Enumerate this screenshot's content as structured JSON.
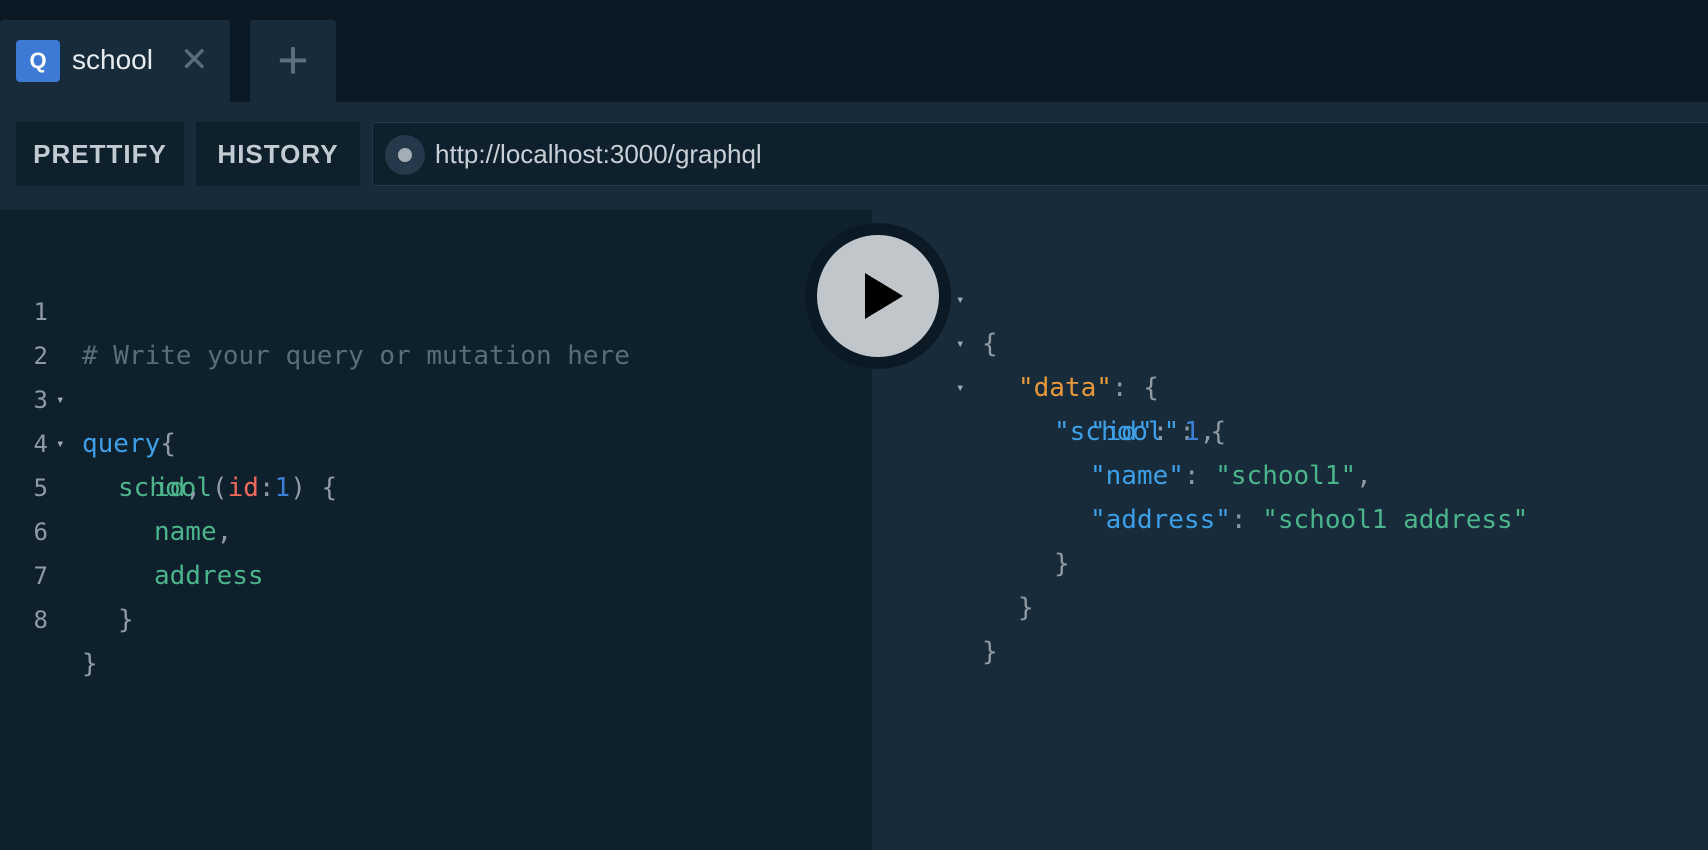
{
  "tabs": [
    {
      "badge": "Q",
      "title": "school",
      "close_glyph": "✕"
    }
  ],
  "add_tab_glyph": "+",
  "toolbar": {
    "prettify_label": "PRETTIFY",
    "history_label": "HISTORY",
    "endpoint_url": "http://localhost:3000/graphql"
  },
  "editor": {
    "line_numbers": [
      "1",
      "2",
      "3",
      "4",
      "5",
      "6",
      "7",
      "8"
    ],
    "lines": {
      "l1_comment": "# Write your query or mutation here",
      "l2_keyword": "query",
      "l2_brace": "{",
      "l3_field": "school",
      "l3_open": "(",
      "l3_arg": "id",
      "l3_colon": ":",
      "l3_value": "1",
      "l3_close": ") {",
      "l4_field": "id",
      "l4_comma": ",",
      "l5_field": "name",
      "l5_comma": ",",
      "l6_field": "address",
      "l7_brace": "}",
      "l8_brace": "}"
    }
  },
  "result": {
    "open_brace": "{",
    "data_key": "\"data\"",
    "school_key": "\"school\"",
    "id_key": "\"id\"",
    "id_value": "1",
    "name_key": "\"name\"",
    "name_value": "\"school1\"",
    "address_key": "\"address\"",
    "address_value": "\"school1 address\"",
    "colon_brace": ": {",
    "colon": ": ",
    "comma": ",",
    "close_brace": "}"
  },
  "icons": {
    "fold": "▾",
    "run": "play-icon"
  },
  "colors": {
    "accent": "#3d7ad6",
    "editor_bg": "#0f202d",
    "result_bg": "#172b3a",
    "keyword": "#3e9fe7",
    "field": "#4cb48a",
    "argument": "#ef6a5a",
    "data_key": "#e69a3c"
  }
}
